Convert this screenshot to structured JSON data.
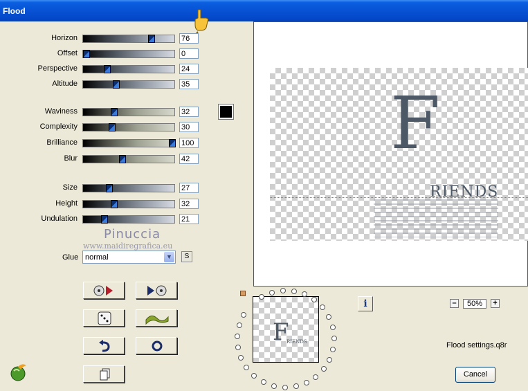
{
  "window": {
    "title": "Flood"
  },
  "sliders": [
    {
      "label": "Horizon",
      "value": "76",
      "level": 76
    },
    {
      "label": "Offset",
      "value": "0",
      "level": 0
    },
    {
      "label": "Perspective",
      "value": "24",
      "level": 24
    },
    {
      "label": "Altitude",
      "value": "35",
      "level": 35
    },
    {
      "label": "Waviness",
      "value": "32",
      "level": 32
    },
    {
      "label": "Complexity",
      "value": "30",
      "level": 30
    },
    {
      "label": "Brilliance",
      "value": "100",
      "level": 100
    },
    {
      "label": "Blur",
      "value": "42",
      "level": 42
    },
    {
      "label": "Size",
      "value": "27",
      "level": 27
    },
    {
      "label": "Height",
      "value": "32",
      "level": 32
    },
    {
      "label": "Undulation",
      "value": "21",
      "level": 21
    }
  ],
  "color_swatch": {
    "color": "#000000"
  },
  "watermark": {
    "name": "Pinuccia",
    "site": "www.maidiregrafica.eu"
  },
  "glue": {
    "label": "Glue",
    "value": "normal",
    "side_button": "S"
  },
  "preview": {
    "big_letter": "F",
    "word": "RIENDS",
    "small_letter": "F",
    "small_word": "RIENDS"
  },
  "icons": {
    "hand": "pointing-hand-icon",
    "load_preset": "disc-arrow-icon",
    "save_preset": "arrow-disc-icon",
    "randomize": "dice-icon",
    "effect": "wave-icon",
    "undo": "undo-arrow-icon",
    "reset": "ring-icon",
    "copy": "copy-pages-icon",
    "logo": "plugin-logo-icon"
  },
  "info_button": {
    "label": "i"
  },
  "zoom": {
    "minus": "–",
    "value": "50%",
    "plus": "+"
  },
  "settings_file": "Flood settings.q8r",
  "cancel_button": "Cancel"
}
